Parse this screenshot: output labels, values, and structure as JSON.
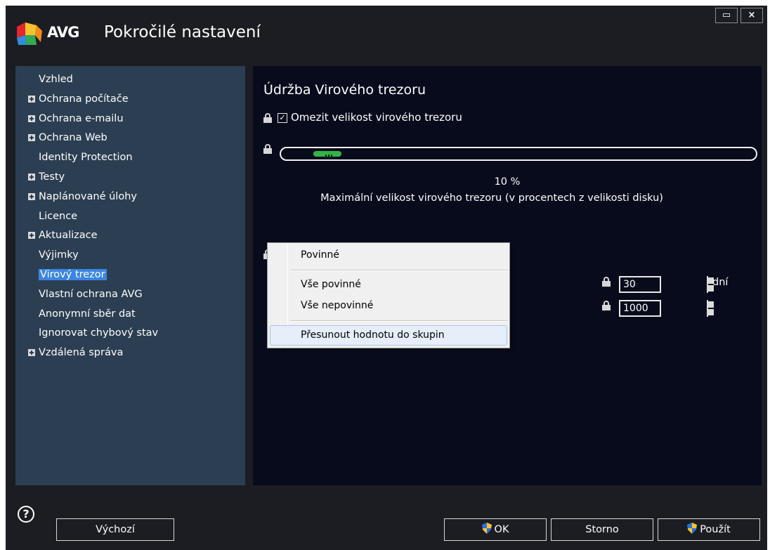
{
  "window": {
    "brand": "AVG",
    "title": "Pokročilé nastavení",
    "restore_glyph": "▭",
    "close_glyph": "×"
  },
  "sidebar": {
    "items": [
      {
        "label": "Vzhled",
        "expandable": false,
        "selected": false
      },
      {
        "label": "Ochrana počítače",
        "expandable": true,
        "selected": false
      },
      {
        "label": "Ochrana e-mailu",
        "expandable": true,
        "selected": false
      },
      {
        "label": "Ochrana Web",
        "expandable": true,
        "selected": false
      },
      {
        "label": "Identity Protection",
        "expandable": false,
        "selected": false
      },
      {
        "label": "Testy",
        "expandable": true,
        "selected": false
      },
      {
        "label": "Naplánované úlohy",
        "expandable": true,
        "selected": false
      },
      {
        "label": "Licence",
        "expandable": false,
        "selected": false
      },
      {
        "label": "Aktualizace",
        "expandable": true,
        "selected": false
      },
      {
        "label": "Výjimky",
        "expandable": false,
        "selected": false
      },
      {
        "label": "Virový trezor",
        "expandable": false,
        "selected": true
      },
      {
        "label": "Vlastní ochrana AVG",
        "expandable": false,
        "selected": false
      },
      {
        "label": "Anonymní sběr dat",
        "expandable": false,
        "selected": false
      },
      {
        "label": "Ignorovat chybový stav",
        "expandable": false,
        "selected": false
      },
      {
        "label": "Vzdálená správa",
        "expandable": true,
        "selected": false
      }
    ]
  },
  "content": {
    "section_title": "Údržba Virového trezoru",
    "limit_checkbox": {
      "label": "Omezit velikost virového trezoru",
      "checked": true,
      "glyph": "✓"
    },
    "size_slider": {
      "value_percent": 10,
      "display": "10 %"
    },
    "slider_description": "Maximální velikost virového trezoru (v procentech z velikosti disku)",
    "fields": [
      {
        "value": "30",
        "unit": "dní"
      },
      {
        "value": "1000",
        "unit": ""
      }
    ]
  },
  "context_menu": {
    "items": [
      "Povinné",
      "Vše povinné",
      "Vše nepovinné",
      "Přesunout hodnotu do skupin"
    ],
    "highlighted_index": 3
  },
  "footer": {
    "help_glyph": "?",
    "default_label": "Výchozí",
    "ok_label": "OK",
    "cancel_label": "Storno",
    "apply_label": "Použít"
  },
  "colors": {
    "window_bg": "#1b1d22",
    "sidebar_bg": "#2c3e52",
    "content_bg": "#070b1c",
    "selection": "#3c86e2",
    "slider_fill": "#33b34a"
  }
}
